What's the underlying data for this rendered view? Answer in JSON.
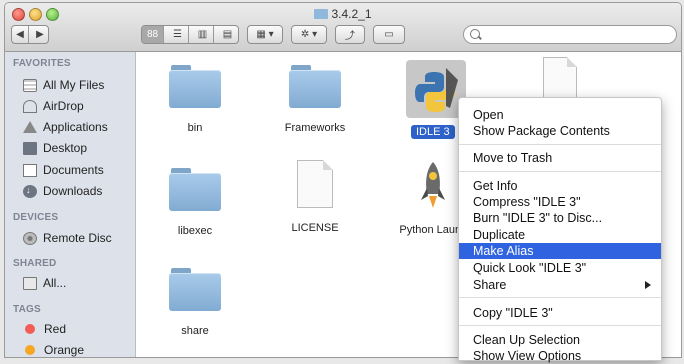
{
  "window": {
    "title": "3.4.2_1"
  },
  "toolbar": {
    "nav": [
      "◀",
      "▶"
    ],
    "view_buttons": [
      "88",
      "☰",
      "▥",
      "▤"
    ],
    "arrange_label": "▦ ▾",
    "action_label": "✲ ▾",
    "share_label": "⤴",
    "tag_label": "▭"
  },
  "search": {
    "placeholder": "",
    "value": ""
  },
  "sidebar": {
    "favorites_heading": "FAVORITES",
    "favorites": [
      "All My Files",
      "AirDrop",
      "Applications",
      "Desktop",
      "Documents",
      "Downloads"
    ],
    "devices_heading": "DEVICES",
    "devices": [
      "Remote Disc"
    ],
    "shared_heading": "SHARED",
    "shared": [
      "All..."
    ],
    "tags_heading": "TAGS",
    "tags": [
      {
        "label": "Red",
        "color": "#f25c57"
      },
      {
        "label": "Orange",
        "color": "#f5a623"
      }
    ]
  },
  "files": {
    "bin": "bin",
    "frameworks": "Frameworks",
    "idle": "IDLE 3",
    "libexec": "libexec",
    "license": "LICENSE",
    "python_launcher": "Python Launc",
    "share": "share"
  },
  "context_menu": {
    "open": "Open",
    "show_package_contents": "Show Package Contents",
    "move_to_trash": "Move to Trash",
    "get_info": "Get Info",
    "compress": "Compress \"IDLE 3\"",
    "burn": "Burn \"IDLE 3\" to Disc...",
    "duplicate": "Duplicate",
    "make_alias": "Make Alias",
    "quick_look": "Quick Look \"IDLE 3\"",
    "share": "Share",
    "copy": "Copy \"IDLE 3\"",
    "clean_up": "Clean Up Selection",
    "show_view_options": "Show View Options"
  },
  "colors": {
    "highlight": "#2f63e0",
    "folder": "#8fb6dc",
    "selection": "#2e62c9"
  }
}
